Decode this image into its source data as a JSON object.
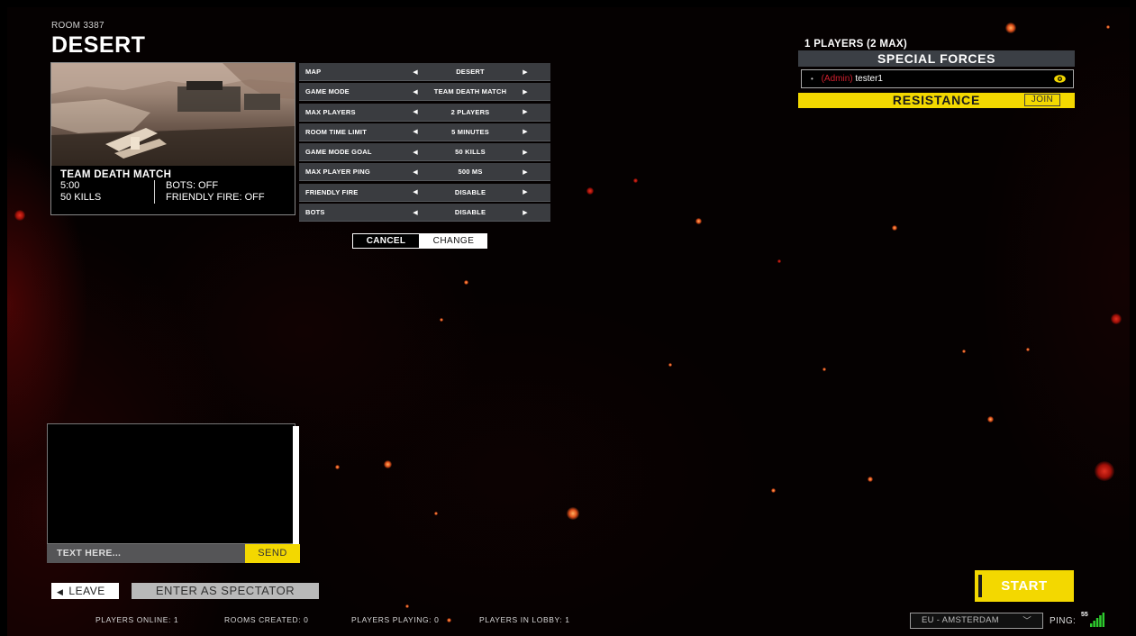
{
  "room": {
    "number_label": "ROOM 3387",
    "name": "DESERT"
  },
  "map_card": {
    "mode": "TEAM DEATH MATCH",
    "time": "5:00",
    "bots": "BOTS: OFF",
    "kills": "50 KILLS",
    "friendly_fire": "FRIENDLY FIRE: OFF"
  },
  "settings": [
    {
      "label": "MAP",
      "value": "DESERT"
    },
    {
      "label": "GAME MODE",
      "value": "TEAM DEATH MATCH"
    },
    {
      "label": "MAX PLAYERS",
      "value": "2 PLAYERS"
    },
    {
      "label": "ROOM TIME LIMIT",
      "value": "5 MINUTES"
    },
    {
      "label": "GAME MODE GOAL",
      "value": "50 KILLS"
    },
    {
      "label": "MAX PLAYER PING",
      "value": "500 MS"
    },
    {
      "label": "FRIENDLY FIRE",
      "value": "DISABLE"
    },
    {
      "label": "BOTS",
      "value": "DISABLE"
    }
  ],
  "arrows": {
    "left": "◀",
    "right": "▶"
  },
  "actions": {
    "cancel": "CANCEL",
    "change": "CHANGE"
  },
  "teams": {
    "players_count": "1 PLAYERS (2 MAX)",
    "team_a": {
      "name": "SPECIAL FORCES",
      "players": [
        {
          "dot": "•",
          "role": "(Admin)",
          "name": "tester1",
          "icon": "eye-icon"
        }
      ]
    },
    "team_b": {
      "name": "RESISTANCE",
      "join_label": "JOIN"
    }
  },
  "chat": {
    "placeholder": "TEXT HERE...",
    "send_label": "SEND"
  },
  "nav": {
    "leave_chevron": "◀",
    "leave_label": "LEAVE",
    "spectator_label": "ENTER AS SPECTATOR",
    "start_label": "START"
  },
  "stats": {
    "players_online": "PLAYERS ONLINE: 1",
    "rooms_created": "ROOMS CREATED: 0",
    "players_playing": "PLAYERS PLAYING: 0",
    "players_in_lobby": "PLAYERS IN LOBBY: 1"
  },
  "region": {
    "label": "EU - AMSTERDAM",
    "chevron": "﹀"
  },
  "ping": {
    "label": "PING:",
    "value": "55"
  },
  "colors": {
    "accent_yellow": "#f3d800",
    "admin_red": "#d0202e",
    "setting_bg": "#3a3c40",
    "signal_green": "#2ecc2e"
  }
}
